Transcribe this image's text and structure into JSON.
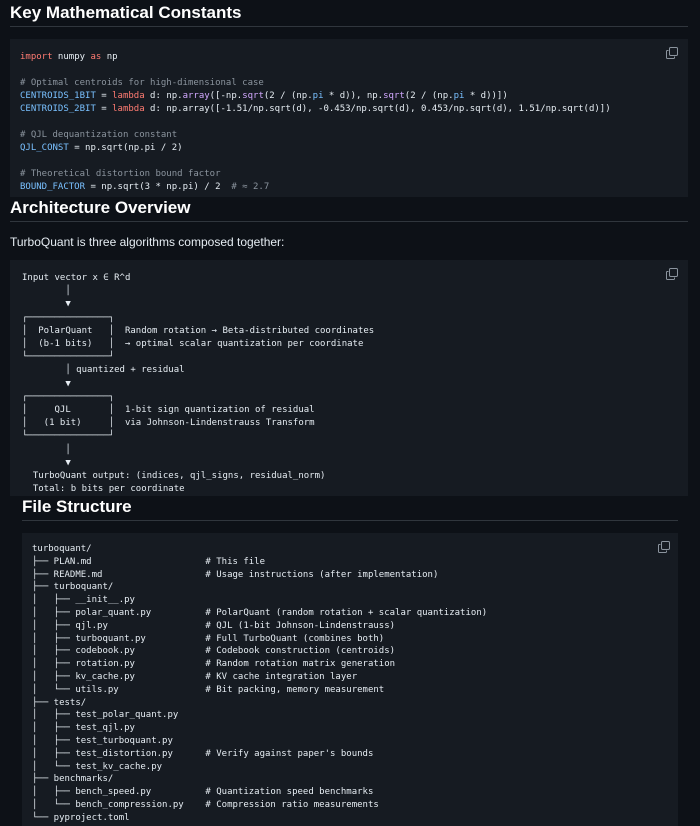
{
  "sections": {
    "constants": {
      "title": "Key Mathematical Constants"
    },
    "architecture": {
      "title": "Architecture Overview",
      "intro": "TurboQuant is three algorithms composed together:"
    },
    "file_structure": {
      "title": "File Structure"
    }
  },
  "code": {
    "import_kw": "import",
    "import_mod": " numpy ",
    "import_as": "as",
    "import_alias": " np",
    "c1": "# Optimal centroids for high-dimensional case",
    "c1b_name": "CENTROIDS_1BIT",
    "eq": " = ",
    "lambda": "lambda",
    "c1b_rest_a": " d: np.",
    "array": "array",
    "c1b_rest_b": "([-np.",
    "sqrt": "sqrt",
    "c1b_rest_c": "(2 / (np.",
    "pi": "pi",
    "c1b_rest_d": " * d)), np.",
    "c1b_rest_e": "(2 / (np.",
    "c1b_rest_f": " * d))])",
    "c2b_name": "CENTROIDS_2BIT",
    "c2b_rest": " d: np.array([-1.51/np.sqrt(d), -0.453/np.sqrt(d), 0.453/np.sqrt(d), 1.51/np.sqrt(d)])",
    "c2": "# QJL dequantization constant",
    "qjl_name": "QJL_CONST",
    "qjl_rest": " = np.sqrt(np.pi / 2)",
    "c3": "# Theoretical distortion bound factor",
    "bound_name": "BOUND_FACTOR",
    "bound_rest": " = np.sqrt(3 * np.pi) / 2",
    "bound_cm": "  # ≈ 2.7"
  },
  "diagram": {
    "text": "Input vector x ∈ R^d\n        │\n        ▼\n┌───────────────┐\n│  PolarQuant   │  Random rotation → Beta-distributed coordinates\n│  (b-1 bits)   │  → optimal scalar quantization per coordinate\n└───────────────┘\n        │ quantized + residual\n        ▼\n┌───────────────┐\n│     QJL       │  1-bit sign quantization of residual\n│   (1 bit)     │  via Johnson-Lindenstrauss Transform\n└───────────────┘\n        │\n        ▼\n  TurboQuant output: (indices, qjl_signs, residual_norm)\n  Total: b bits per coordinate"
  },
  "tree": {
    "text": "turboquant/\n├── PLAN.md                     # This file\n├── README.md                   # Usage instructions (after implementation)\n├── turboquant/\n│   ├── __init__.py\n│   ├── polar_quant.py          # PolarQuant (random rotation + scalar quantization)\n│   ├── qjl.py                  # QJL (1-bit Johnson-Lindenstrauss)\n│   ├── turboquant.py           # Full TurboQuant (combines both)\n│   ├── codebook.py             # Codebook construction (centroids)\n│   ├── rotation.py             # Random rotation matrix generation\n│   ├── kv_cache.py             # KV cache integration layer\n│   └── utils.py                # Bit packing, memory measurement\n├── tests/\n│   ├── test_polar_quant.py\n│   ├── test_qjl.py\n│   ├── test_turboquant.py\n│   ├── test_distortion.py      # Verify against paper's bounds\n│   └── test_kv_cache.py\n├── benchmarks/\n│   ├── bench_speed.py          # Quantization speed benchmarks\n│   └── bench_compression.py    # Compression ratio measurements\n└── pyproject.toml"
  },
  "icons": {
    "copy": "copy-icon"
  },
  "colors": {
    "background": "#0d1117",
    "code_bg": "#161b22",
    "keyword": "#ff7b72",
    "comment": "#8b949e",
    "constant": "#79c0ff",
    "function": "#d2a8ff"
  }
}
